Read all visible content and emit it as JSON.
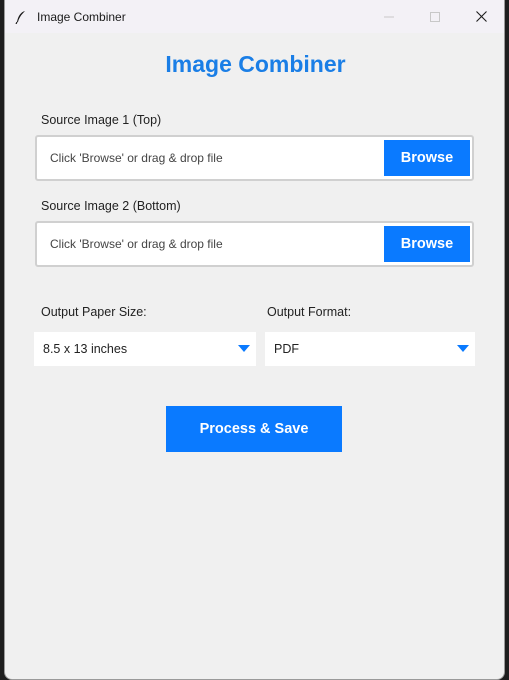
{
  "window": {
    "title": "Image Combiner",
    "icon": "feather-icon"
  },
  "app": {
    "heading": "Image Combiner",
    "accent_color": "#0a7aff",
    "heading_color": "#1a7ee6"
  },
  "source1": {
    "label": "Source Image 1 (Top)",
    "hint": "Click 'Browse' or drag & drop file",
    "button": "Browse"
  },
  "source2": {
    "label": "Source Image 2 (Bottom)",
    "hint": "Click 'Browse' or drag & drop file",
    "button": "Browse"
  },
  "paper_size": {
    "label": "Output Paper Size:",
    "value": "8.5 x 13 inches"
  },
  "format": {
    "label": "Output Format:",
    "value": "PDF"
  },
  "actions": {
    "process_label": "Process & Save"
  }
}
